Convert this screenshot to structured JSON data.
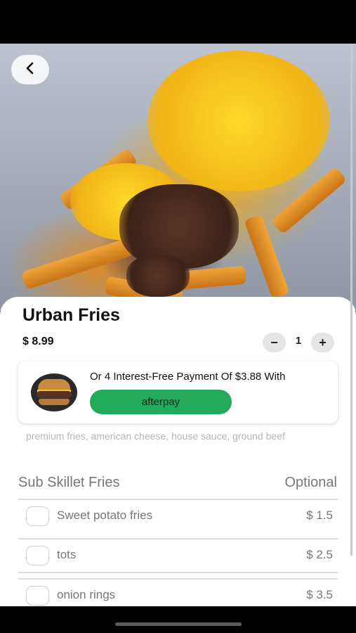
{
  "product": {
    "title": "Urban Fries",
    "price": "$ 8.99",
    "description": "premium fries, american cheese, house sauce, ground beef"
  },
  "quantity": {
    "minus_label": "−",
    "value": "1",
    "plus_label": "+"
  },
  "afterpay": {
    "offer_text": "Or 4 Interest-Free Payment Of $3.88 With",
    "button_label": "afterpay"
  },
  "options_section": {
    "title": "Sub Skillet Fries",
    "badge": "Optional",
    "items": [
      {
        "name": "Sweet potato fries",
        "price": "$ 1.5",
        "checked": false
      },
      {
        "name": "tots",
        "price": "$ 2.5",
        "checked": false
      },
      {
        "name": "onion rings",
        "price": "$ 3.5",
        "checked": false
      }
    ]
  },
  "colors": {
    "afterpay_green": "#22a95a",
    "muted_text": "#777777"
  },
  "icons": {
    "back": "chevron-left-icon"
  }
}
